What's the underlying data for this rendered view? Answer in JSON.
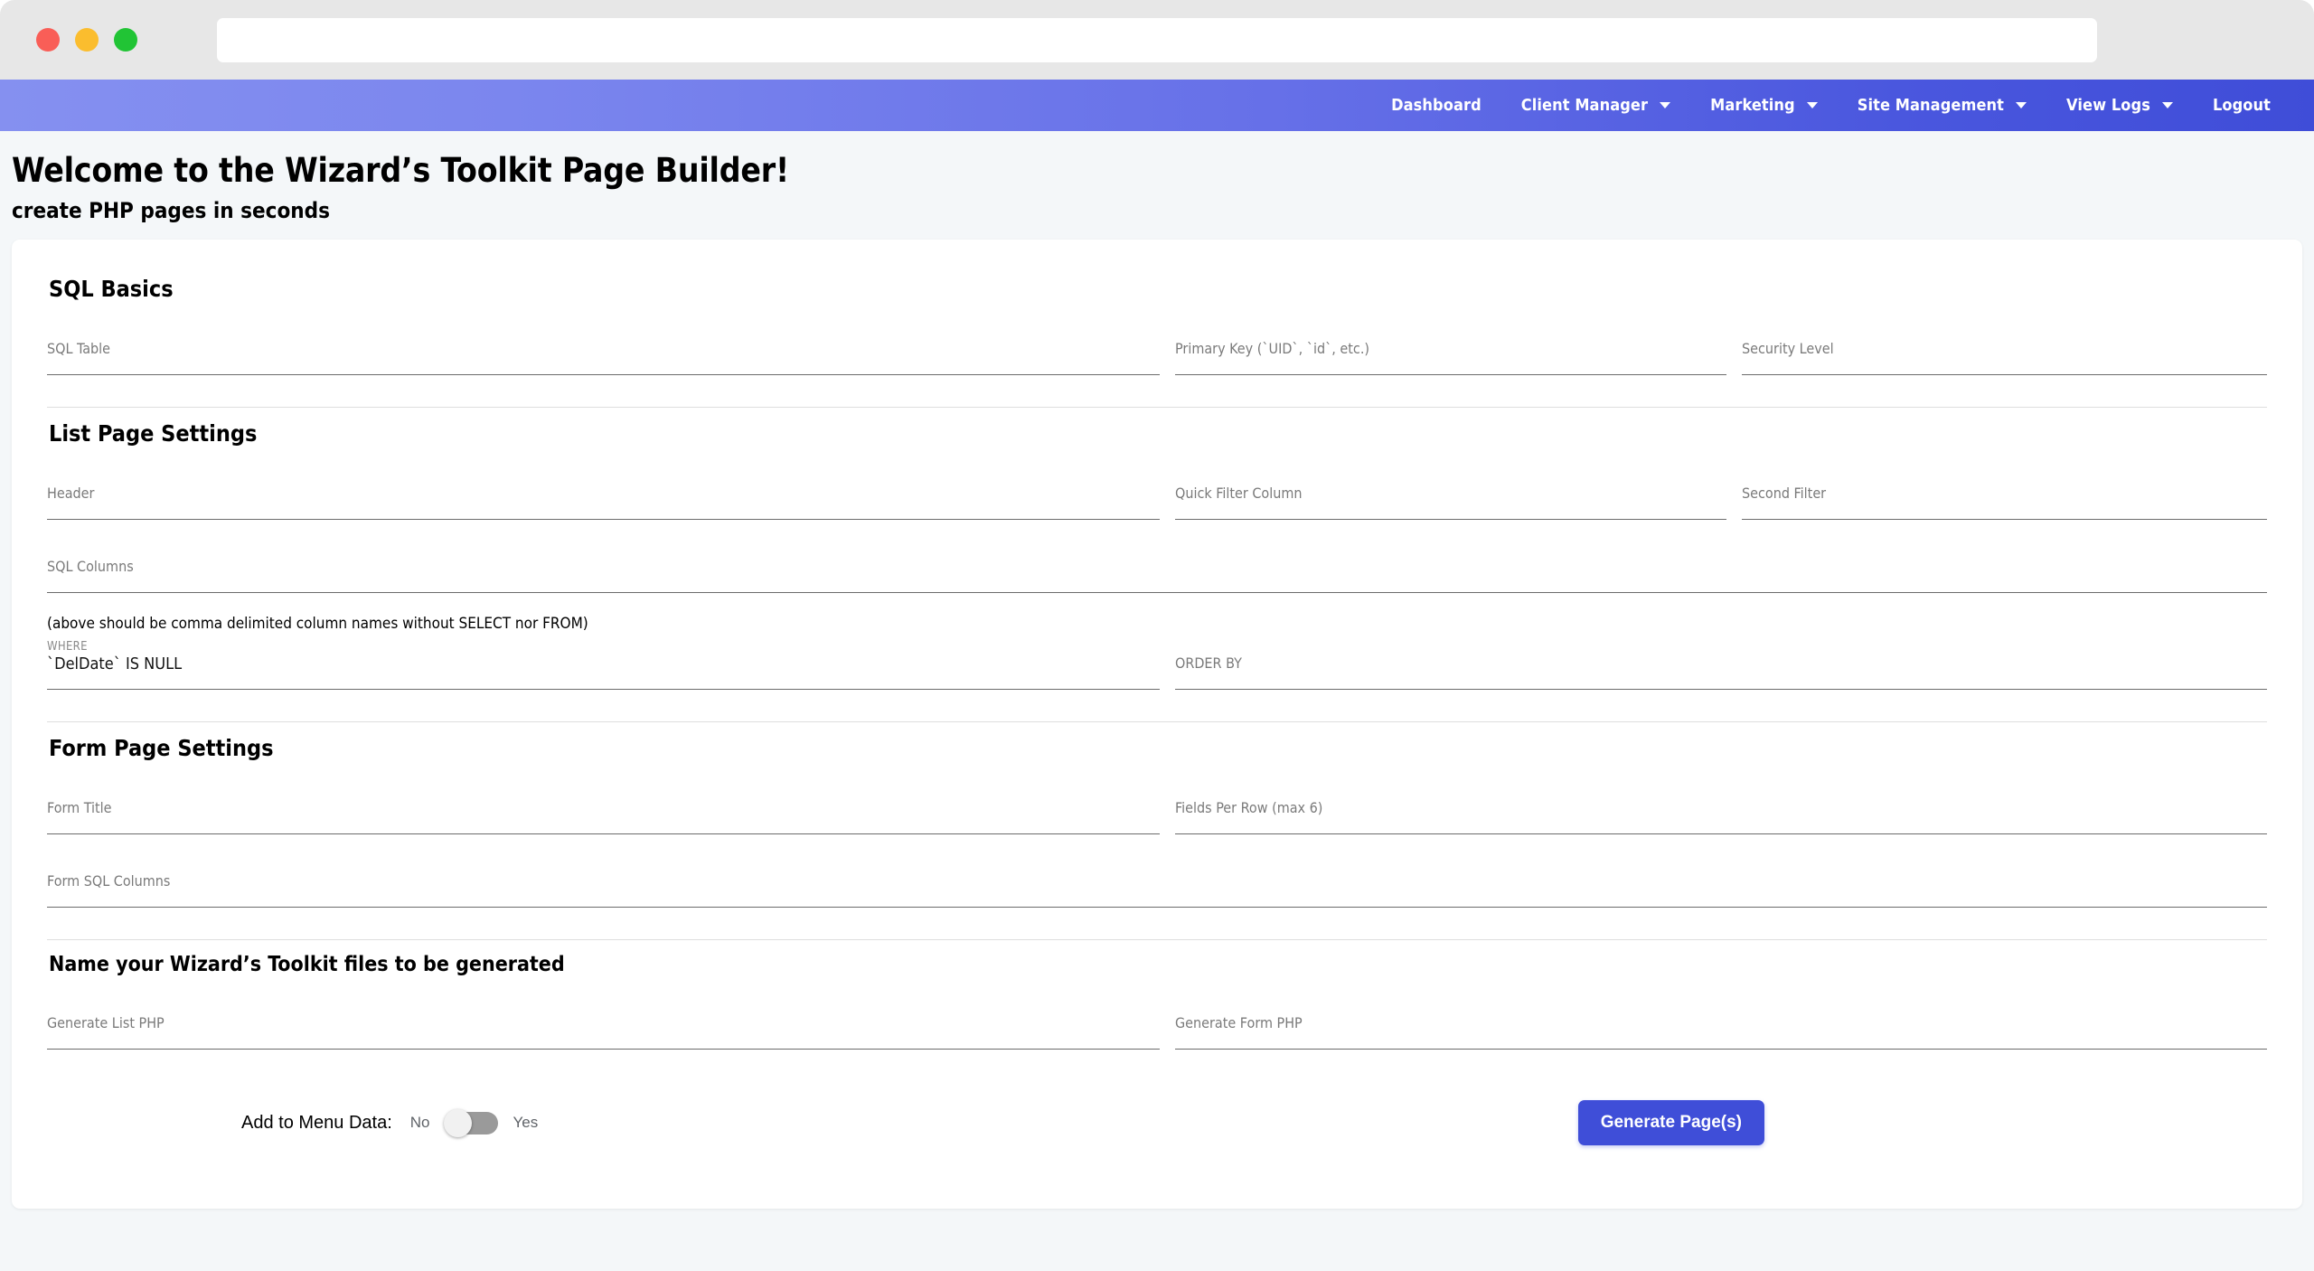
{
  "browser": {
    "url_value": "",
    "url_placeholder": ""
  },
  "nav": {
    "items": [
      {
        "label": "Dashboard",
        "has_caret": false
      },
      {
        "label": "Client Manager",
        "has_caret": true
      },
      {
        "label": "Marketing",
        "has_caret": true
      },
      {
        "label": "Site Management",
        "has_caret": true
      },
      {
        "label": "View Logs",
        "has_caret": true
      },
      {
        "label": "Logout",
        "has_caret": false
      }
    ]
  },
  "hero": {
    "title": "Welcome to the Wizard’s Toolkit Page Builder!",
    "subtitle": "create PHP pages in seconds"
  },
  "sections": {
    "sql_basics": {
      "title": "SQL Basics",
      "sql_table": {
        "placeholder": "SQL Table",
        "value": ""
      },
      "primary_key": {
        "placeholder": "Primary Key (`UID`, `id`, etc.)",
        "value": ""
      },
      "security_level": {
        "placeholder": "Security Level",
        "value": ""
      }
    },
    "list_page_settings": {
      "title": "List Page Settings",
      "header": {
        "placeholder": "Header",
        "value": ""
      },
      "quick_filter_column": {
        "placeholder": "Quick Filter Column",
        "value": ""
      },
      "second_filter": {
        "placeholder": "Second Filter",
        "value": ""
      },
      "sql_columns": {
        "placeholder": "SQL Columns",
        "value": ""
      },
      "note": "(above should be comma delimited column names without SELECT nor FROM)",
      "where": {
        "label": "WHERE",
        "value": "`DelDate` IS NULL"
      },
      "order_by": {
        "placeholder": "ORDER BY",
        "value": ""
      }
    },
    "form_page_settings": {
      "title": "Form Page Settings",
      "form_title": {
        "placeholder": "Form Title",
        "value": ""
      },
      "fields_per_row": {
        "placeholder": "Fields Per Row (max 6)",
        "value": ""
      },
      "form_sql_columns": {
        "placeholder": "Form SQL Columns",
        "value": ""
      }
    },
    "file_names": {
      "title": "Name your Wizard’s Toolkit files to be generated",
      "generate_list_php": {
        "placeholder": "Generate List PHP",
        "value": ""
      },
      "generate_form_php": {
        "placeholder": "Generate Form PHP",
        "value": ""
      }
    }
  },
  "footer": {
    "toggle_label": "Add to Menu Data:",
    "toggle_off_label": "No",
    "toggle_on_label": "Yes",
    "toggle_state": "off",
    "submit_label": "Generate Page(s)"
  },
  "colors": {
    "nav_gradient_start": "#8590f0",
    "nav_gradient_end": "#3f4dd8",
    "primary_button": "#3f4ed8",
    "page_background": "#f4f7f9",
    "card_background": "#ffffff"
  }
}
